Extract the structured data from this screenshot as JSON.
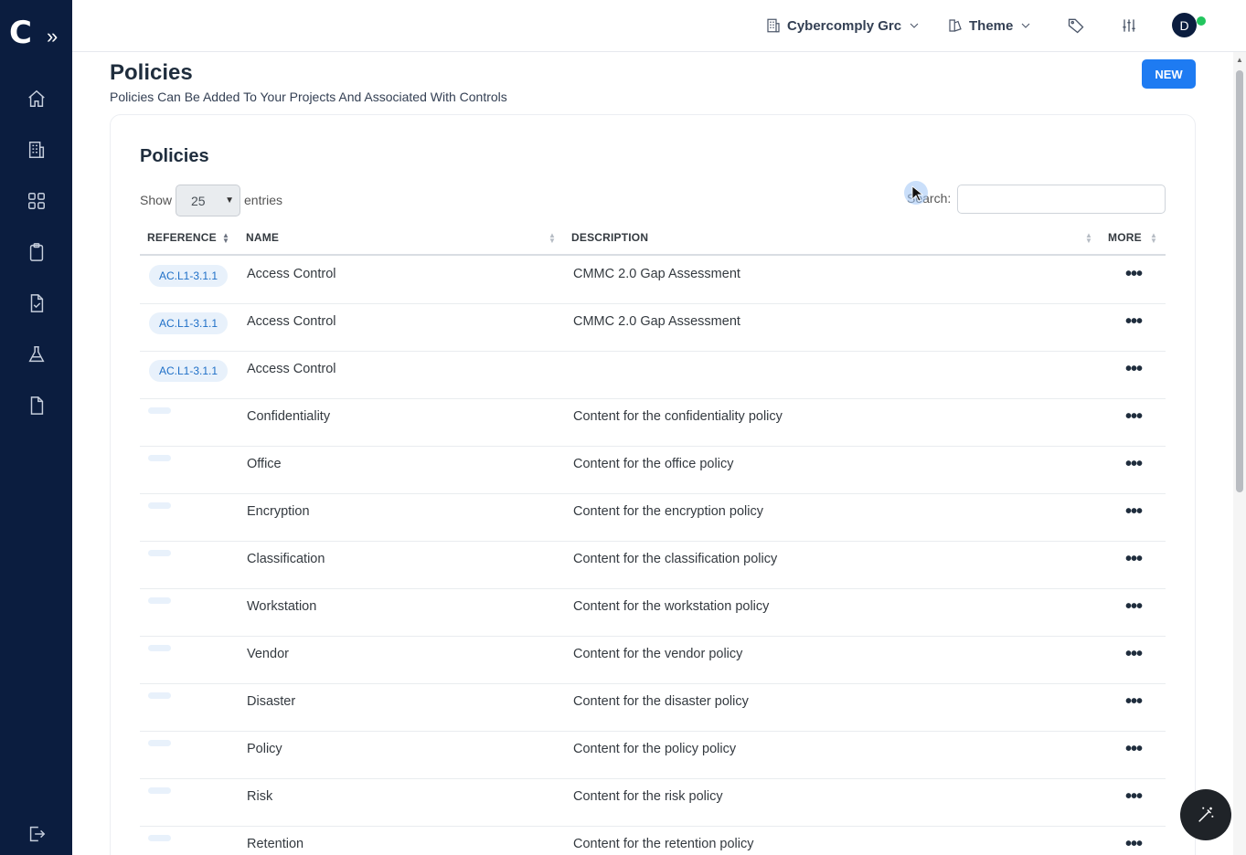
{
  "sidebar": {
    "logo": "C",
    "expand_icon": "chevrons-right-icon",
    "items": [
      {
        "icon": "home-icon"
      },
      {
        "icon": "building-icon"
      },
      {
        "icon": "grid-icon"
      },
      {
        "icon": "clipboard-icon"
      },
      {
        "icon": "file-check-icon"
      },
      {
        "icon": "flask-icon"
      },
      {
        "icon": "file-icon"
      },
      {
        "icon": "logout-icon"
      }
    ]
  },
  "topbar": {
    "org_label": "Cybercomply Grc",
    "theme_label": "Theme",
    "avatar_initial": "D",
    "status_color": "#22c55e"
  },
  "page": {
    "title": "Policies",
    "subtitle": "Policies Can Be Added To Your Projects And Associated With Controls",
    "new_button": "NEW"
  },
  "card": {
    "title": "Policies",
    "show_label": "Show",
    "page_size": "25",
    "entries_label": "entries",
    "search_label": "Search:",
    "search_value": ""
  },
  "table": {
    "headers": {
      "reference": "REFERENCE",
      "name": "NAME",
      "description": "DESCRIPTION",
      "more": "MORE"
    },
    "rows": [
      {
        "reference": "AC.L1-3.1.1",
        "name": "Access Control",
        "description": "CMMC 2.0 Gap Assessment"
      },
      {
        "reference": "AC.L1-3.1.1",
        "name": "Access Control",
        "description": "CMMC 2.0 Gap Assessment"
      },
      {
        "reference": "AC.L1-3.1.1",
        "name": "Access Control",
        "description": ""
      },
      {
        "reference": "",
        "name": "Confidentiality",
        "description": "Content for the confidentiality policy"
      },
      {
        "reference": "",
        "name": "Office",
        "description": "Content for the office policy"
      },
      {
        "reference": "",
        "name": "Encryption",
        "description": "Content for the encryption policy"
      },
      {
        "reference": "",
        "name": "Classification",
        "description": "Content for the classification policy"
      },
      {
        "reference": "",
        "name": "Workstation",
        "description": "Content for the workstation policy"
      },
      {
        "reference": "",
        "name": "Vendor",
        "description": "Content for the vendor policy"
      },
      {
        "reference": "",
        "name": "Disaster",
        "description": "Content for the disaster policy"
      },
      {
        "reference": "",
        "name": "Policy",
        "description": "Content for the policy policy"
      },
      {
        "reference": "",
        "name": "Risk",
        "description": "Content for the risk policy"
      },
      {
        "reference": "",
        "name": "Retention",
        "description": "Content for the retention policy"
      }
    ]
  },
  "colors": {
    "sidebar_bg": "#0b1d3f",
    "accent": "#1e7bf2",
    "badge_bg": "#e8f1fb",
    "badge_text": "#1e6fc7"
  }
}
